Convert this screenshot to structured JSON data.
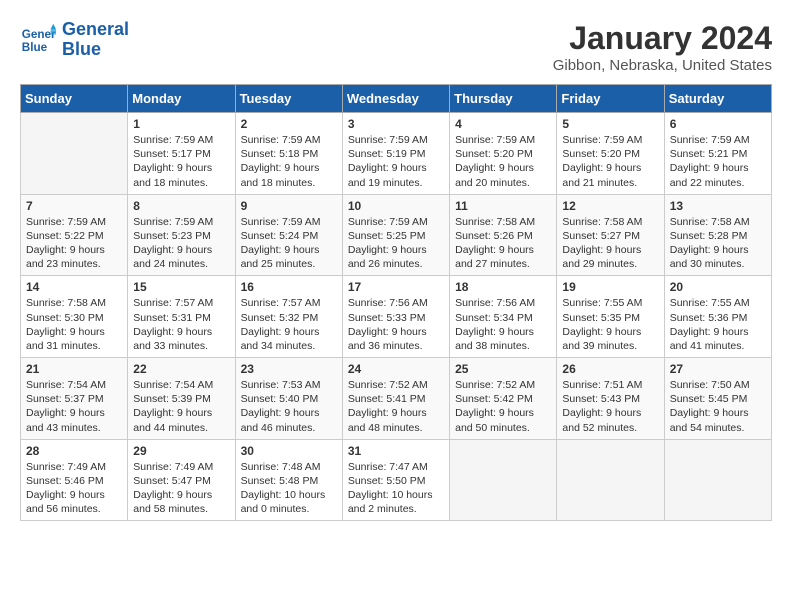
{
  "logo": {
    "brand1": "General",
    "brand2": "Blue"
  },
  "title": "January 2024",
  "subtitle": "Gibbon, Nebraska, United States",
  "days_of_week": [
    "Sunday",
    "Monday",
    "Tuesday",
    "Wednesday",
    "Thursday",
    "Friday",
    "Saturday"
  ],
  "weeks": [
    [
      {
        "day": "",
        "lines": []
      },
      {
        "day": "1",
        "lines": [
          "Sunrise: 7:59 AM",
          "Sunset: 5:17 PM",
          "Daylight: 9 hours",
          "and 18 minutes."
        ]
      },
      {
        "day": "2",
        "lines": [
          "Sunrise: 7:59 AM",
          "Sunset: 5:18 PM",
          "Daylight: 9 hours",
          "and 18 minutes."
        ]
      },
      {
        "day": "3",
        "lines": [
          "Sunrise: 7:59 AM",
          "Sunset: 5:19 PM",
          "Daylight: 9 hours",
          "and 19 minutes."
        ]
      },
      {
        "day": "4",
        "lines": [
          "Sunrise: 7:59 AM",
          "Sunset: 5:20 PM",
          "Daylight: 9 hours",
          "and 20 minutes."
        ]
      },
      {
        "day": "5",
        "lines": [
          "Sunrise: 7:59 AM",
          "Sunset: 5:20 PM",
          "Daylight: 9 hours",
          "and 21 minutes."
        ]
      },
      {
        "day": "6",
        "lines": [
          "Sunrise: 7:59 AM",
          "Sunset: 5:21 PM",
          "Daylight: 9 hours",
          "and 22 minutes."
        ]
      }
    ],
    [
      {
        "day": "7",
        "lines": [
          "Sunrise: 7:59 AM",
          "Sunset: 5:22 PM",
          "Daylight: 9 hours",
          "and 23 minutes."
        ]
      },
      {
        "day": "8",
        "lines": [
          "Sunrise: 7:59 AM",
          "Sunset: 5:23 PM",
          "Daylight: 9 hours",
          "and 24 minutes."
        ]
      },
      {
        "day": "9",
        "lines": [
          "Sunrise: 7:59 AM",
          "Sunset: 5:24 PM",
          "Daylight: 9 hours",
          "and 25 minutes."
        ]
      },
      {
        "day": "10",
        "lines": [
          "Sunrise: 7:59 AM",
          "Sunset: 5:25 PM",
          "Daylight: 9 hours",
          "and 26 minutes."
        ]
      },
      {
        "day": "11",
        "lines": [
          "Sunrise: 7:58 AM",
          "Sunset: 5:26 PM",
          "Daylight: 9 hours",
          "and 27 minutes."
        ]
      },
      {
        "day": "12",
        "lines": [
          "Sunrise: 7:58 AM",
          "Sunset: 5:27 PM",
          "Daylight: 9 hours",
          "and 29 minutes."
        ]
      },
      {
        "day": "13",
        "lines": [
          "Sunrise: 7:58 AM",
          "Sunset: 5:28 PM",
          "Daylight: 9 hours",
          "and 30 minutes."
        ]
      }
    ],
    [
      {
        "day": "14",
        "lines": [
          "Sunrise: 7:58 AM",
          "Sunset: 5:30 PM",
          "Daylight: 9 hours",
          "and 31 minutes."
        ]
      },
      {
        "day": "15",
        "lines": [
          "Sunrise: 7:57 AM",
          "Sunset: 5:31 PM",
          "Daylight: 9 hours",
          "and 33 minutes."
        ]
      },
      {
        "day": "16",
        "lines": [
          "Sunrise: 7:57 AM",
          "Sunset: 5:32 PM",
          "Daylight: 9 hours",
          "and 34 minutes."
        ]
      },
      {
        "day": "17",
        "lines": [
          "Sunrise: 7:56 AM",
          "Sunset: 5:33 PM",
          "Daylight: 9 hours",
          "and 36 minutes."
        ]
      },
      {
        "day": "18",
        "lines": [
          "Sunrise: 7:56 AM",
          "Sunset: 5:34 PM",
          "Daylight: 9 hours",
          "and 38 minutes."
        ]
      },
      {
        "day": "19",
        "lines": [
          "Sunrise: 7:55 AM",
          "Sunset: 5:35 PM",
          "Daylight: 9 hours",
          "and 39 minutes."
        ]
      },
      {
        "day": "20",
        "lines": [
          "Sunrise: 7:55 AM",
          "Sunset: 5:36 PM",
          "Daylight: 9 hours",
          "and 41 minutes."
        ]
      }
    ],
    [
      {
        "day": "21",
        "lines": [
          "Sunrise: 7:54 AM",
          "Sunset: 5:37 PM",
          "Daylight: 9 hours",
          "and 43 minutes."
        ]
      },
      {
        "day": "22",
        "lines": [
          "Sunrise: 7:54 AM",
          "Sunset: 5:39 PM",
          "Daylight: 9 hours",
          "and 44 minutes."
        ]
      },
      {
        "day": "23",
        "lines": [
          "Sunrise: 7:53 AM",
          "Sunset: 5:40 PM",
          "Daylight: 9 hours",
          "and 46 minutes."
        ]
      },
      {
        "day": "24",
        "lines": [
          "Sunrise: 7:52 AM",
          "Sunset: 5:41 PM",
          "Daylight: 9 hours",
          "and 48 minutes."
        ]
      },
      {
        "day": "25",
        "lines": [
          "Sunrise: 7:52 AM",
          "Sunset: 5:42 PM",
          "Daylight: 9 hours",
          "and 50 minutes."
        ]
      },
      {
        "day": "26",
        "lines": [
          "Sunrise: 7:51 AM",
          "Sunset: 5:43 PM",
          "Daylight: 9 hours",
          "and 52 minutes."
        ]
      },
      {
        "day": "27",
        "lines": [
          "Sunrise: 7:50 AM",
          "Sunset: 5:45 PM",
          "Daylight: 9 hours",
          "and 54 minutes."
        ]
      }
    ],
    [
      {
        "day": "28",
        "lines": [
          "Sunrise: 7:49 AM",
          "Sunset: 5:46 PM",
          "Daylight: 9 hours",
          "and 56 minutes."
        ]
      },
      {
        "day": "29",
        "lines": [
          "Sunrise: 7:49 AM",
          "Sunset: 5:47 PM",
          "Daylight: 9 hours",
          "and 58 minutes."
        ]
      },
      {
        "day": "30",
        "lines": [
          "Sunrise: 7:48 AM",
          "Sunset: 5:48 PM",
          "Daylight: 10 hours",
          "and 0 minutes."
        ]
      },
      {
        "day": "31",
        "lines": [
          "Sunrise: 7:47 AM",
          "Sunset: 5:50 PM",
          "Daylight: 10 hours",
          "and 2 minutes."
        ]
      },
      {
        "day": "",
        "lines": []
      },
      {
        "day": "",
        "lines": []
      },
      {
        "day": "",
        "lines": []
      }
    ]
  ]
}
